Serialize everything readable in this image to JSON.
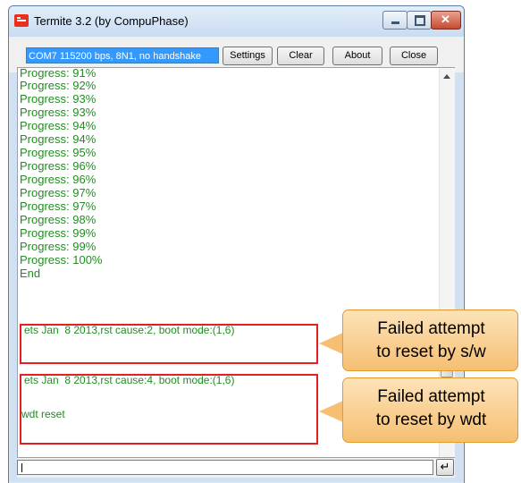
{
  "window": {
    "title": "Termite 3.2 (by CompuPhase)"
  },
  "toolbar": {
    "port_status": "COM7 115200 bps, 8N1, no handshake",
    "settings_label": "Settings",
    "clear_label": "Clear",
    "about_label": "About",
    "close_label": "Close"
  },
  "output": {
    "lines": [
      "Progress: 91%",
      "Progress: 92%",
      "Progress: 93%",
      "Progress: 93%",
      "Progress: 94%",
      "Progress: 94%",
      "Progress: 95%",
      "Progress: 96%",
      "Progress: 96%",
      "Progress: 97%",
      "Progress: 97%",
      "Progress: 98%",
      "Progress: 99%",
      "Progress: 99%",
      "Progress: 100%",
      "End",
      "ets Jan  8 2013,rst cause:2, boot mode:(1,6)",
      "ets Jan  8 2013,rst cause:4, boot mode:(1,6)",
      "wdt reset"
    ]
  },
  "input": {
    "value": ""
  },
  "enter_icon": "↵",
  "callouts": [
    {
      "line1": "Failed attempt",
      "line2": "to reset by s/w"
    },
    {
      "line1": "Failed attempt",
      "line2": "to reset by wdt"
    }
  ],
  "colors": {
    "output_text": "#1e8f1e",
    "highlight": "#e41f1f",
    "callout": "#f6bf72"
  }
}
